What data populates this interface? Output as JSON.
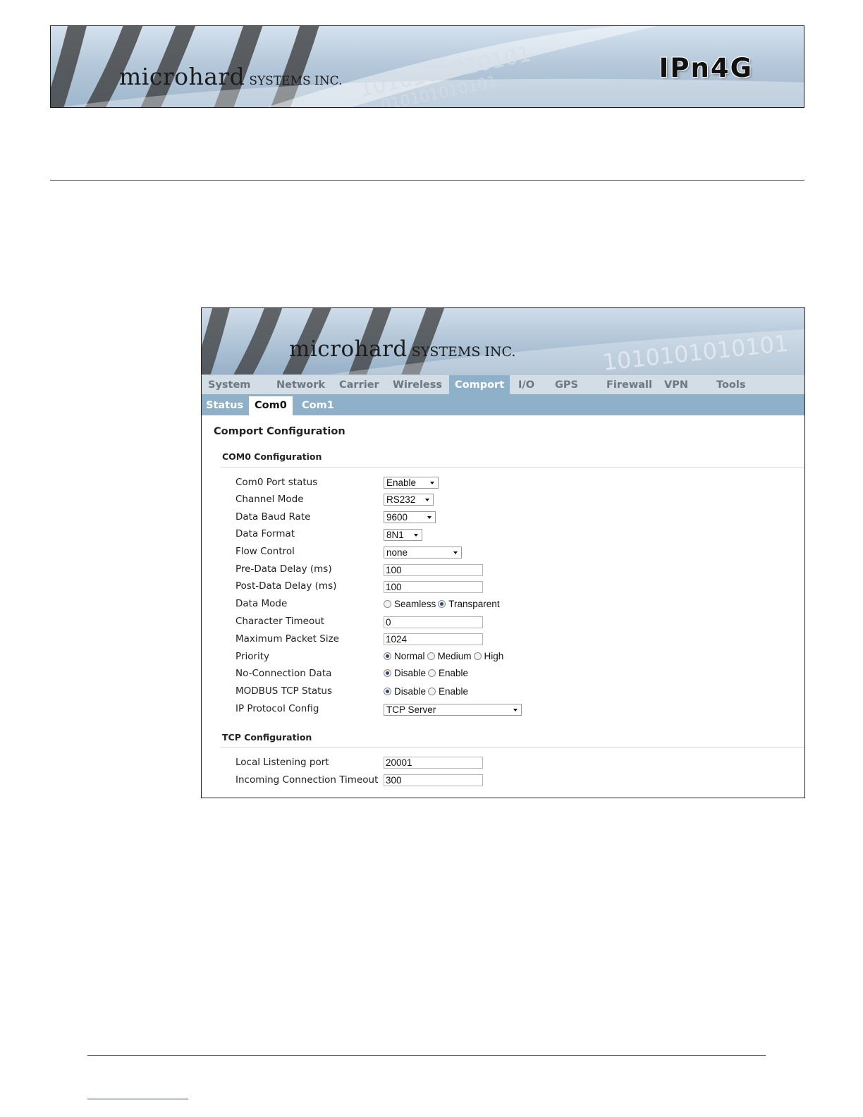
{
  "doc_header": {
    "brand": "microhard",
    "brand_suffix": "SYSTEMS INC.",
    "product": "IPn4G"
  },
  "screenshot": {
    "brand": "microhard",
    "brand_suffix": "SYSTEMS INC.",
    "main_tabs": [
      "System",
      "Network",
      "Carrier",
      "Wireless",
      "Comport",
      "I/O",
      "GPS",
      "Firewall",
      "VPN",
      "Tools"
    ],
    "active_main_tab": "Comport",
    "sub_tabs": [
      "Status",
      "Com0",
      "Com1"
    ],
    "active_sub_tab": "Com0",
    "page_title": "Comport Configuration",
    "com0_section": {
      "title": "COM0 Configuration",
      "port_status": {
        "label": "Com0 Port status",
        "value": "Enable"
      },
      "channel_mode": {
        "label": "Channel Mode",
        "value": "RS232"
      },
      "baud_rate": {
        "label": "Data Baud Rate",
        "value": "9600"
      },
      "data_format": {
        "label": "Data Format",
        "value": "8N1"
      },
      "flow_control": {
        "label": "Flow Control",
        "value": "none"
      },
      "pre_delay": {
        "label": "Pre-Data Delay (ms)",
        "value": "100"
      },
      "post_delay": {
        "label": "Post-Data Delay (ms)",
        "value": "100"
      },
      "data_mode": {
        "label": "Data Mode",
        "options": [
          "Seamless",
          "Transparent"
        ],
        "selected": "Transparent"
      },
      "char_timeout": {
        "label": "Character Timeout",
        "value": "0"
      },
      "max_packet": {
        "label": "Maximum Packet Size",
        "value": "1024"
      },
      "priority": {
        "label": "Priority",
        "options": [
          "Normal",
          "Medium",
          "High"
        ],
        "selected": "Normal"
      },
      "no_conn_data": {
        "label": "No-Connection Data",
        "options": [
          "Disable",
          "Enable"
        ],
        "selected": "Disable"
      },
      "modbus_tcp": {
        "label": "MODBUS TCP Status",
        "options": [
          "Disable",
          "Enable"
        ],
        "selected": "Disable"
      },
      "ip_protocol": {
        "label": "IP Protocol Config",
        "value": "TCP Server"
      }
    },
    "tcp_section": {
      "title": "TCP Configuration",
      "listen_port": {
        "label": "Local Listening port",
        "value": "20001"
      },
      "conn_timeout": {
        "label": "Incoming Connection Timeout",
        "value": "300"
      }
    }
  }
}
